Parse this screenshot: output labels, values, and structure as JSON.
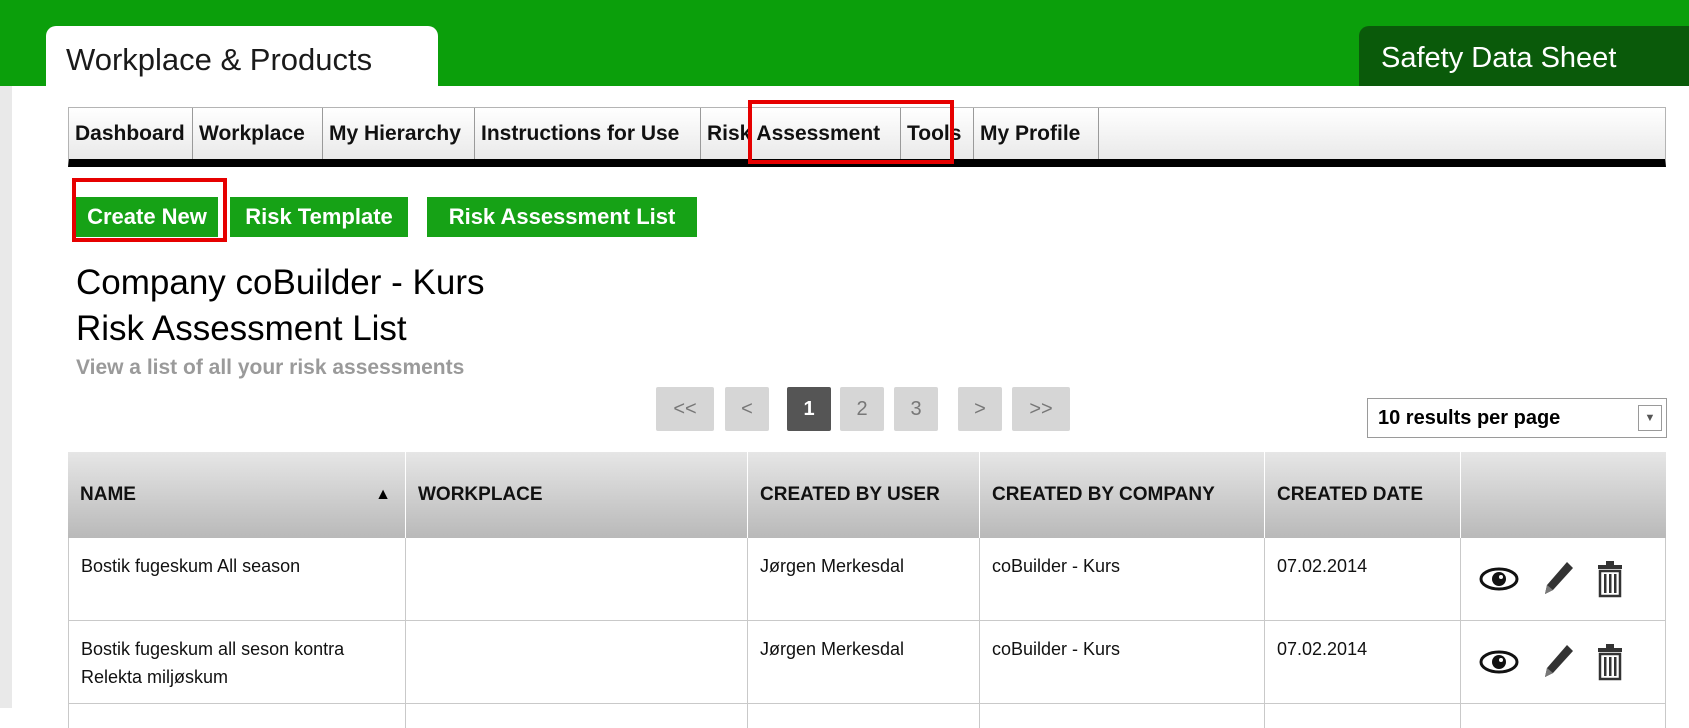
{
  "header": {
    "active_tab": "Workplace & Products",
    "right_tab": "Safety Data Sheet"
  },
  "nav": {
    "items": [
      "Dashboard",
      "Workplace",
      "My Hierarchy",
      "Instructions for Use",
      "Risk Assessment",
      "Tools",
      "My Profile"
    ]
  },
  "subnav": {
    "create_new": "Create New",
    "risk_template": "Risk Template",
    "risk_assessment_list": "Risk Assessment List"
  },
  "page": {
    "company": "Company coBuilder - Kurs",
    "title": "Risk Assessment List",
    "subtitle": "View a list of all your risk assessments"
  },
  "pager": {
    "first": "<<",
    "prev": "<",
    "pages": [
      "1",
      "2",
      "3"
    ],
    "current": "1",
    "next": ">",
    "last": ">>"
  },
  "per_page": {
    "selected": "10 results per page"
  },
  "table": {
    "headers": [
      "NAME",
      "WORKPLACE",
      "CREATED BY USER",
      "CREATED BY COMPANY",
      "CREATED DATE",
      ""
    ],
    "rows": [
      {
        "name": "Bostik fugeskum All season",
        "workplace": "",
        "user": "Jørgen Merkesdal",
        "company": "coBuilder - Kurs",
        "date": "07.02.2014"
      },
      {
        "name": "Bostik fugeskum all seson kontra Relekta miljøskum",
        "workplace": "",
        "user": "Jørgen Merkesdal",
        "company": "coBuilder - Kurs",
        "date": "07.02.2014"
      }
    ]
  },
  "colors": {
    "green": "#0b9f0b",
    "dark_green": "#0a5a0a",
    "highlight": "#e60000"
  },
  "icons": [
    "view-eye-icon",
    "edit-pencil-icon",
    "delete-trash-icon",
    "sort-asc-icon"
  ]
}
